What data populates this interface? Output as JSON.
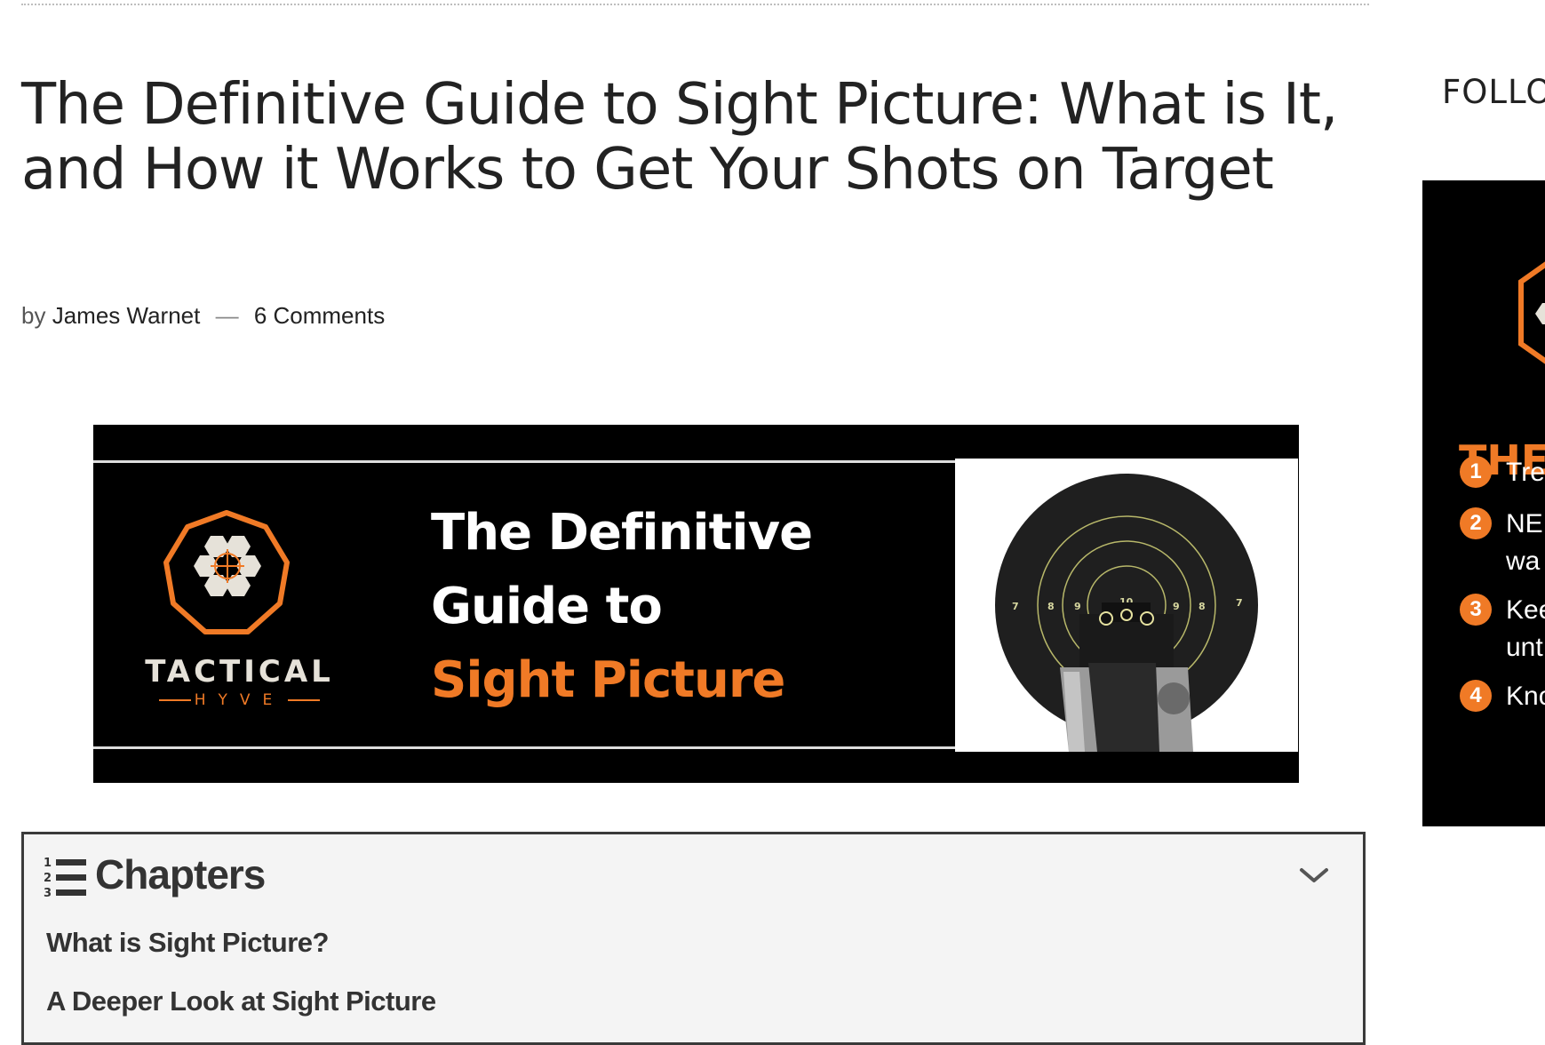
{
  "article": {
    "title": "The Definitive Guide to Sight Picture: What is It, and How it Works to Get Your Shots on Target",
    "byline_prefix": "by",
    "author": "James Warnet",
    "byline_separator": "—",
    "comments": "6 Comments"
  },
  "banner": {
    "brand": "TACTICAL",
    "brand_sub": "HYVE",
    "headline_1": "The Definitive",
    "headline_2": "Guide to",
    "headline_3": "Sight Picture",
    "target_numbers": [
      "7",
      "8",
      "9",
      "10",
      "9",
      "8",
      "7"
    ],
    "accent_color": "#f07a26",
    "image": "pistol-sights-on-target"
  },
  "chapters": {
    "title": "Chapters",
    "icon": "numbered-list-icon",
    "toggle_icon": "chevron-down-icon",
    "items": [
      "What is Sight Picture?",
      "A Deeper Look at Sight Picture"
    ]
  },
  "sidebar": {
    "follow_label": "FOLLO",
    "ad": {
      "headline": "THE",
      "items": [
        {
          "num": "1",
          "lines": [
            "Tre"
          ]
        },
        {
          "num": "2",
          "lines": [
            "NE",
            "wa"
          ]
        },
        {
          "num": "3",
          "lines": [
            "Kee",
            "unt"
          ]
        },
        {
          "num": "4",
          "lines": [
            "Kno"
          ]
        }
      ]
    }
  }
}
